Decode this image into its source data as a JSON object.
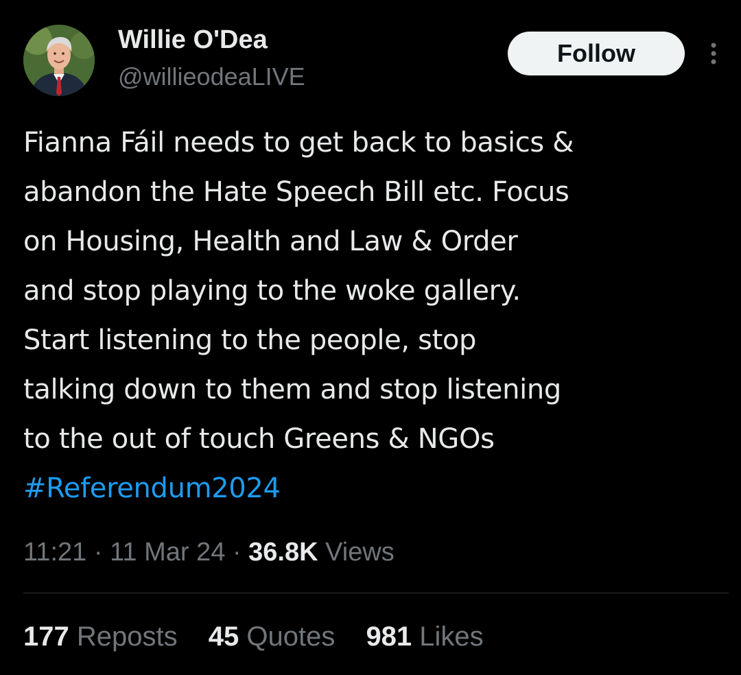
{
  "author": {
    "display_name": "Willie O'Dea",
    "handle": "@willieodeaLIVE",
    "follow_label": "Follow"
  },
  "tweet": {
    "lines": [
      "Fianna Fáil needs to get back to basics &",
      "abandon the Hate Speech Bill etc. Focus",
      "on Housing, Health and Law & Order",
      "and stop playing to the woke gallery.",
      "Start listening to the people, stop",
      "talking down to them and stop listening",
      "to the out of touch Greens & NGOs"
    ],
    "hashtag": "#Referendum2024"
  },
  "meta": {
    "time": "11:21",
    "separator": " · ",
    "date": "11 Mar 24",
    "views_count": "36.8K",
    "views_label": " Views"
  },
  "stats": {
    "reposts_count": "177",
    "reposts_label": " Reposts",
    "quotes_count": "45",
    "quotes_label": " Quotes",
    "likes_count": "981",
    "likes_label": " Likes"
  },
  "colors": {
    "background": "#000000",
    "text_primary": "#e7e9ea",
    "text_secondary": "#71767b",
    "link": "#1d9bf0",
    "follow_bg": "#eff3f4"
  },
  "icons": {
    "more": "more-vertical-icon"
  }
}
